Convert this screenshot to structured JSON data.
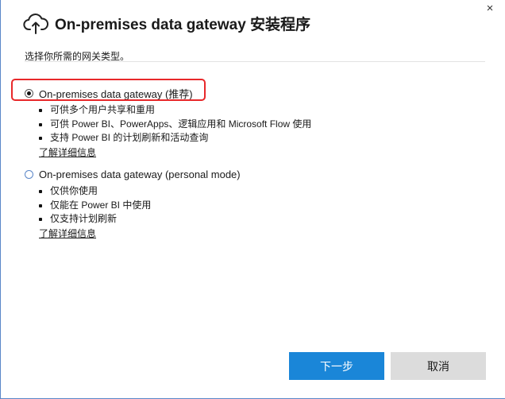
{
  "window": {
    "title": "On-premises data gateway 安装程序",
    "close_label": "×"
  },
  "prompt": "选择你所需的网关类型。",
  "options": [
    {
      "label": "On-premises data gateway (推荐)",
      "selected": true,
      "features": [
        "可供多个用户共享和重用",
        "可供 Power BI、PowerApps、逻辑应用和 Microsoft Flow 使用",
        "支持 Power BI 的计划刷新和活动查询"
      ],
      "learn_more": "了解详细信息"
    },
    {
      "label": "On-premises data gateway (personal mode)",
      "selected": false,
      "features": [
        "仅供你使用",
        "仅能在 Power BI 中使用",
        "仅支持计划刷新"
      ],
      "learn_more": "了解详细信息"
    }
  ],
  "buttons": {
    "next": "下一步",
    "cancel": "取消"
  },
  "colors": {
    "primary_button": "#1a86d8",
    "highlight": "#e8282a",
    "secondary_button": "#dcdcdc"
  }
}
